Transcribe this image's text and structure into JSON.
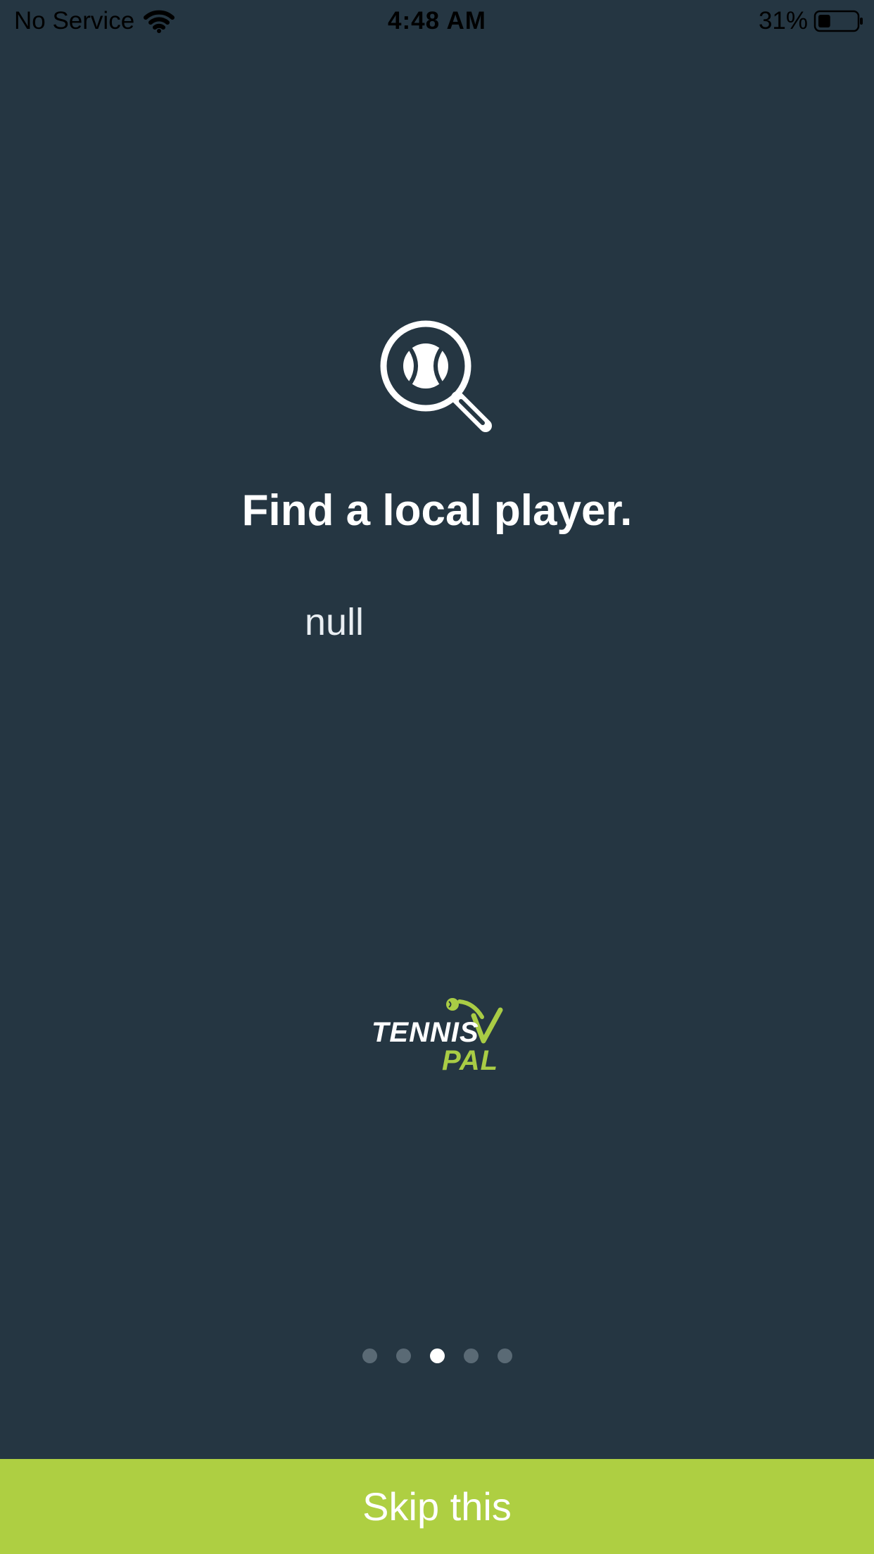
{
  "status_bar": {
    "carrier": "No Service",
    "time": "4:48 AM",
    "battery_percent": "31%",
    "battery_level": 0.31
  },
  "onboarding": {
    "title": "Find a local player.",
    "subtitle": "null",
    "icon": "search-tennis-ball-icon"
  },
  "logo": {
    "word1": "TENNIS",
    "word2": "PAL",
    "accent_color": "#a9cc45"
  },
  "pager": {
    "total_pages": 5,
    "current_page": 3
  },
  "skip_button": {
    "label": "Skip this"
  },
  "colors": {
    "background": "#253642",
    "button": "#aecf42",
    "dot_active": "#ffffff",
    "dot_inactive": "#5a6a75"
  }
}
